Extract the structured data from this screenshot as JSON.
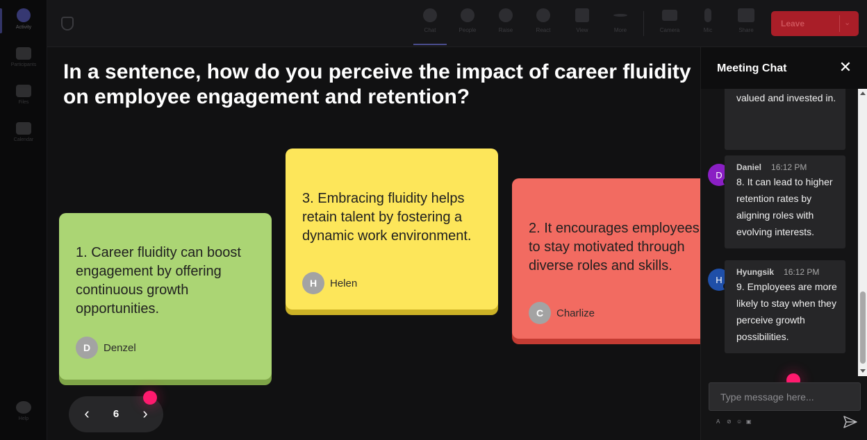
{
  "rail": {
    "items": [
      {
        "label": "Activity"
      },
      {
        "label": "Participants"
      },
      {
        "label": "Files"
      },
      {
        "label": "Calendar"
      },
      {
        "label": "Help"
      }
    ]
  },
  "toolbar": {
    "tools": [
      {
        "label": "Chat"
      },
      {
        "label": "People"
      },
      {
        "label": "Raise"
      },
      {
        "label": "React"
      },
      {
        "label": "View"
      },
      {
        "label": "More"
      },
      {
        "label": "Camera"
      },
      {
        "label": "Mic"
      },
      {
        "label": "Share"
      }
    ],
    "leave_label": "Leave",
    "colors": {
      "leave": "#b91f2a",
      "active_underline": "#5b5fc7"
    }
  },
  "stage": {
    "question": "In a sentence, how do you perceive the impact of career fluidity on employee engagement and retention?",
    "notes": [
      {
        "text": "1. Career fluidity can boost engagement by offering continuous growth opportunities.",
        "author": "Denzel",
        "initial": "D",
        "color": "#abd574"
      },
      {
        "text": "3. Embracing fluidity helps retain talent by fostering a dynamic work environment.",
        "author": "Helen",
        "initial": "H",
        "color": "#fde65a"
      },
      {
        "text": "2. It encourages employees to stay motivated through diverse roles and skills.",
        "author": "Charlize",
        "initial": "C",
        "color": "#f26b61"
      }
    ],
    "pager": {
      "current": "6",
      "prev_icon": "chevron-left-icon",
      "next_icon": "chevron-right-icon"
    }
  },
  "chat": {
    "title": "Meeting Chat",
    "close_icon": "close-icon",
    "messages": [
      {
        "sender": "",
        "time": "",
        "initial": "",
        "text": "make employees feel valued and invested in."
      },
      {
        "sender": "Daniel",
        "time": "16:12 PM",
        "initial": "D",
        "avatar_color": "#8a1fc4",
        "text": "8. It can lead to higher retention rates by aligning roles with evolving interests."
      },
      {
        "sender": "Hyungsik",
        "time": "16:12 PM",
        "initial": "H",
        "avatar_color": "#1f4fa8",
        "text": "9. Employees are more likely to stay when they perceive growth possibilities."
      }
    ],
    "input_placeholder": "Type message here...",
    "send_icon": "send-icon"
  }
}
